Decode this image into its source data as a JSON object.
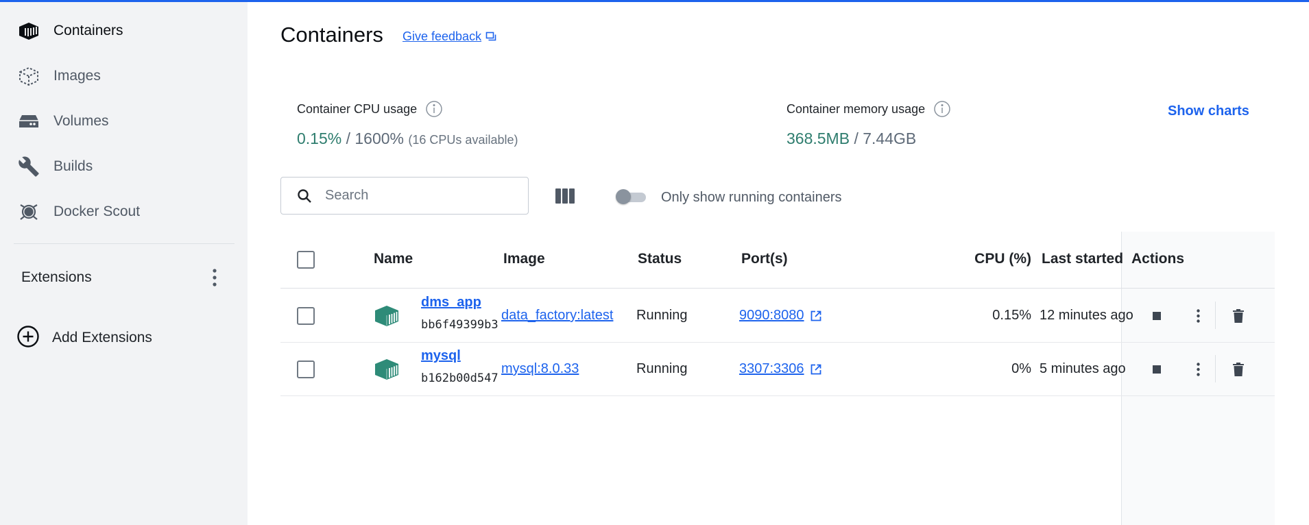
{
  "sidebar": {
    "items": [
      {
        "label": "Containers",
        "icon": "containers-icon",
        "active": true
      },
      {
        "label": "Images",
        "icon": "images-icon"
      },
      {
        "label": "Volumes",
        "icon": "volumes-icon"
      },
      {
        "label": "Builds",
        "icon": "wrench-icon"
      },
      {
        "label": "Docker Scout",
        "icon": "docker-scout-icon"
      }
    ],
    "extensions_label": "Extensions",
    "add_extensions_label": "Add Extensions"
  },
  "header": {
    "title": "Containers",
    "feedback_label": "Give feedback"
  },
  "stats": {
    "cpu": {
      "label": "Container CPU usage",
      "used": "0.15%",
      "sep": " / ",
      "total": "1600%",
      "note": "(16 CPUs available)"
    },
    "memory": {
      "label": "Container memory usage",
      "used": "368.5MB",
      "sep": " / ",
      "total": "7.44GB"
    },
    "show_charts_label": "Show charts"
  },
  "toolbar": {
    "search_placeholder": "Search",
    "toggle_label": "Only show running containers",
    "toggle_on": false
  },
  "table": {
    "headers": {
      "name": "Name",
      "image": "Image",
      "status": "Status",
      "ports": "Port(s)",
      "cpu": "CPU (%)",
      "last_started": "Last started",
      "actions": "Actions"
    },
    "rows": [
      {
        "name": "dms_app",
        "id": "bb6f49399b3",
        "image": "data_factory:latest",
        "status": "Running",
        "port": "9090:8080",
        "cpu": "0.15%",
        "last_started": "12 minutes ago"
      },
      {
        "name": "mysql",
        "id": "b162b00d547",
        "image": "mysql:8.0.33",
        "status": "Running",
        "port": "3307:3306",
        "cpu": "0%",
        "last_started": "5 minutes ago"
      }
    ]
  },
  "colors": {
    "accent": "#1d63ed",
    "container_icon": "#2e8b78",
    "usage_value": "#2e7d6e"
  }
}
